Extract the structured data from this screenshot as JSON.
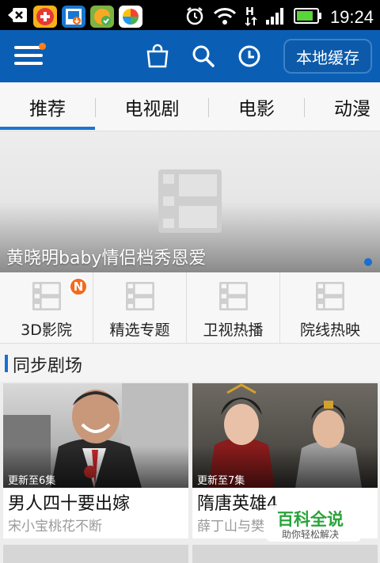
{
  "status_bar": {
    "time": "19:24",
    "icons": [
      "back-arrow-icon",
      "add-app-icon",
      "download-app-icon",
      "sync-app-icon",
      "color-app-icon",
      "alarm-icon",
      "wifi-icon",
      "h-network-icon",
      "signal-icon",
      "battery-icon"
    ]
  },
  "app_bar": {
    "icons": [
      "menu-icon",
      "bag-icon",
      "search-icon",
      "history-icon"
    ],
    "local_cache_label": "本地缓存"
  },
  "tabs": [
    {
      "label": "推荐",
      "selected": true
    },
    {
      "label": "电视剧",
      "selected": false
    },
    {
      "label": "电影",
      "selected": false
    },
    {
      "label": "动漫",
      "selected": false
    }
  ],
  "banner": {
    "title": "黄晓明baby情侣档秀恩爱",
    "icon": "film-placeholder-icon"
  },
  "categories": [
    {
      "label": "3D影院",
      "badge": "N"
    },
    {
      "label": "精选专题"
    },
    {
      "label": "卫视热播"
    },
    {
      "label": "院线热映"
    }
  ],
  "section": {
    "title": "同步剧场"
  },
  "cards": [
    {
      "update": "更新至6集",
      "title": "男人四十要出嫁",
      "subtitle": "宋小宝桃花不断"
    },
    {
      "update": "更新至7集",
      "title": "隋唐英雄4",
      "subtitle": "薛丁山与樊"
    }
  ],
  "watermark": {
    "title": "百科全说",
    "subtitle": "助你轻松解决"
  },
  "colors": {
    "primary_blue": "#0a5fb4",
    "accent_orange": "#f46a1e",
    "selected_tab": "#1d76cf"
  }
}
